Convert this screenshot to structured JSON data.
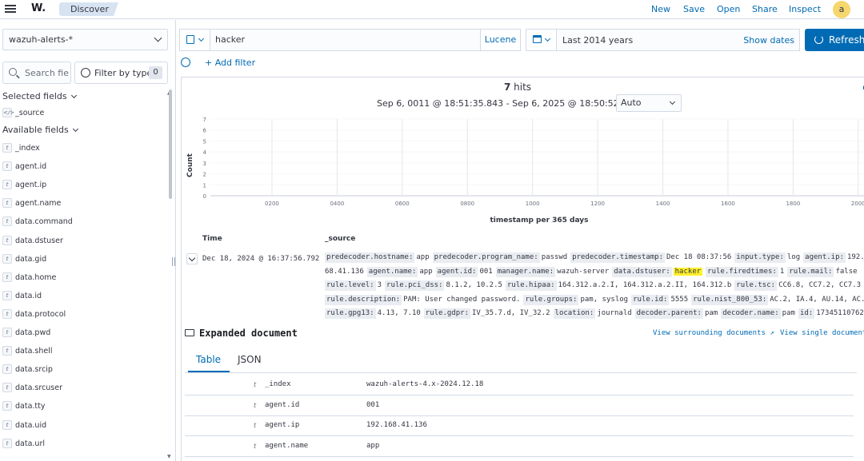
{
  "header": {
    "app_logo": "W.",
    "breadcrumb": "Discover",
    "links": [
      "New",
      "Save",
      "Open",
      "Share",
      "Inspect"
    ],
    "avatar": "a"
  },
  "sidebar": {
    "index_pattern": "wazuh-alerts-*",
    "search_placeholder": "Search fie",
    "filter_by_type_label": "Filter by type",
    "filter_count": "0",
    "selected_fields_label": "Selected fields",
    "selected_fields": [
      {
        "type": "</>",
        "name": "_source"
      }
    ],
    "available_fields_label": "Available fields",
    "available_fields": [
      {
        "type": "t",
        "name": "_index"
      },
      {
        "type": "t",
        "name": "agent.id"
      },
      {
        "type": "t",
        "name": "agent.ip"
      },
      {
        "type": "t",
        "name": "agent.name"
      },
      {
        "type": "t",
        "name": "data.command"
      },
      {
        "type": "t",
        "name": "data.dstuser"
      },
      {
        "type": "t",
        "name": "data.gid"
      },
      {
        "type": "t",
        "name": "data.home"
      },
      {
        "type": "t",
        "name": "data.id"
      },
      {
        "type": "t",
        "name": "data.protocol"
      },
      {
        "type": "t",
        "name": "data.pwd"
      },
      {
        "type": "t",
        "name": "data.shell"
      },
      {
        "type": "t",
        "name": "data.srcip"
      },
      {
        "type": "t",
        "name": "data.srcuser"
      },
      {
        "type": "t",
        "name": "data.tty"
      },
      {
        "type": "t",
        "name": "data.uid"
      },
      {
        "type": "t",
        "name": "data.url"
      }
    ]
  },
  "query": {
    "value": "hacker",
    "language": "Lucene",
    "date_range": "Last 2014 years",
    "show_dates": "Show dates",
    "refresh_label": "Refresh",
    "add_filter": "+ Add filter"
  },
  "results": {
    "hits_count": "7",
    "hits_label": "hits",
    "range_text": "Sep 6, 0011 @ 18:51:35.843 - Sep 6, 2025 @ 18:50:52.843 per",
    "interval": "Auto",
    "col_time": "Time",
    "col_source": "_source",
    "row_time": "Dec 18, 2024 @ 16:37:56.792"
  },
  "chart_data": {
    "type": "bar",
    "ylabel": "Count",
    "xlabel": "timestamp per 365 days",
    "x_ticks": [
      "0200",
      "0400",
      "0600",
      "0800",
      "1000",
      "1200",
      "1400",
      "1600",
      "1800",
      "2000"
    ],
    "y_ticks": [
      "0",
      "1",
      "2",
      "3",
      "4",
      "5",
      "6",
      "7"
    ],
    "ylim": [
      0,
      7
    ],
    "xlim": [
      11,
      2025
    ],
    "grid": true,
    "values": []
  },
  "source_lines": [
    [
      [
        "predecoder.hostname:",
        "app"
      ],
      [
        "predecoder.program_name:",
        "passwd"
      ],
      [
        "predecoder.timestamp:",
        "Dec 18 08:37:56"
      ],
      [
        "input.type:",
        "log"
      ],
      [
        "agent.ip:",
        "192."
      ]
    ],
    [
      [
        "",
        "68.41.136"
      ],
      [
        "agent.name:",
        "app"
      ],
      [
        "agent.id:",
        "001"
      ],
      [
        "manager.name:",
        "wazuh-server"
      ],
      [
        "data.dstuser:",
        "hacker"
      ],
      [
        "rule.firedtimes:",
        "1"
      ],
      [
        "rule.mail:",
        "false"
      ]
    ],
    [
      [
        "rule.level:",
        "3"
      ],
      [
        "rule.pci_dss:",
        "8.1.2, 10.2.5"
      ],
      [
        "rule.hipaa:",
        "164.312.a.2.I, 164.312.a.2.II, 164.312.b"
      ],
      [
        "rule.tsc:",
        "CC6.8, CC7.2, CC7.3"
      ]
    ],
    [
      [
        "rule.description:",
        "PAM: User changed password."
      ],
      [
        "rule.groups:",
        "pam, syslog"
      ],
      [
        "rule.id:",
        "5555"
      ],
      [
        "rule.nist_800_53:",
        "AC.2, IA.4, AU.14, AC.7"
      ]
    ],
    [
      [
        "rule.gpg13:",
        "4.13, 7.10"
      ],
      [
        "rule.gdpr:",
        "IV_35.7.d, IV_32.2"
      ],
      [
        "location:",
        "journald"
      ],
      [
        "decoder.parent:",
        "pam"
      ],
      [
        "decoder.name:",
        "pam"
      ],
      [
        "id:",
        "17345110762"
      ]
    ]
  ],
  "expanded": {
    "title": "Expanded document",
    "surrounding": "View surrounding documents",
    "single": "View single document",
    "tab_table": "Table",
    "tab_json": "JSON",
    "rows": [
      {
        "type": "t",
        "field": "_index",
        "value": "wazuh-alerts-4.x-2024.12.18"
      },
      {
        "type": "t",
        "field": "agent.id",
        "value": "001"
      },
      {
        "type": "t",
        "field": "agent.ip",
        "value": "192.168.41.136"
      },
      {
        "type": "t",
        "field": "agent.name",
        "value": "app"
      }
    ]
  },
  "colors": {
    "primary": "#006bb4",
    "highlight": "#fff02a",
    "avatar": "#f5d76e"
  }
}
